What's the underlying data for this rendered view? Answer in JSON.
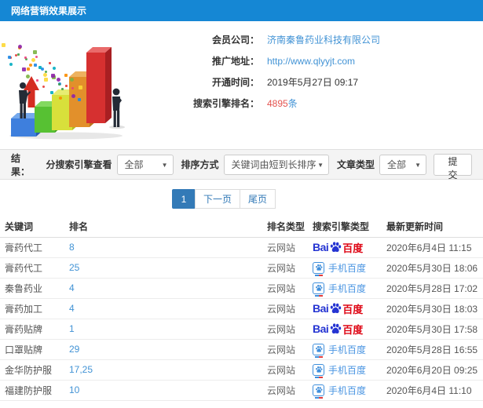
{
  "window": {
    "title": "网络营销效果展示"
  },
  "info": {
    "fields": [
      {
        "label": "会员公司：",
        "value": "济南秦鲁药业科技有限公司"
      },
      {
        "label": "推广地址：",
        "value": "http://www.qlyyjt.com"
      },
      {
        "label": "开通时间：",
        "value": "2019年5月27日 09:17"
      },
      {
        "label": "搜索引擎排名：",
        "value": "4895",
        "unit": "条"
      }
    ]
  },
  "filters": {
    "section_label": "结果：",
    "engine_filter": {
      "label": "分搜索引擎查看",
      "selected": "全部"
    },
    "sort_filter": {
      "label": "排序方式",
      "selected": "关键词由短到长排序"
    },
    "article_type_filter": {
      "label": "文章类型",
      "selected": "全部"
    },
    "submit_label": "提交"
  },
  "pagination": {
    "current": "1",
    "next_label": "下一页",
    "last_label": "尾页"
  },
  "table": {
    "columns": [
      "关键词",
      "排名",
      "排名类型",
      "搜索引擎类型",
      "最新更新时间"
    ],
    "logos": {
      "baidu_bai": "Bai",
      "baidu_du": "百度",
      "mobile_text": "手机百度"
    },
    "rows": [
      {
        "keyword": "膏药代工",
        "rank": "8",
        "rank_type": "云网站",
        "engine": "百度",
        "updated": "2020年6月4日 11:15"
      },
      {
        "keyword": "膏药代工",
        "rank": "25",
        "rank_type": "云网站",
        "engine": "手机百度",
        "updated": "2020年5月30日 18:06"
      },
      {
        "keyword": "秦鲁药业",
        "rank": "4",
        "rank_type": "云网站",
        "engine": "手机百度",
        "updated": "2020年5月28日 17:02"
      },
      {
        "keyword": "膏药加工",
        "rank": "4",
        "rank_type": "云网站",
        "engine": "百度",
        "updated": "2020年5月30日 18:03"
      },
      {
        "keyword": "膏药贴牌",
        "rank": "1",
        "rank_type": "云网站",
        "engine": "百度",
        "updated": "2020年5月30日 17:58"
      },
      {
        "keyword": "口罩贴牌",
        "rank": "29",
        "rank_type": "云网站",
        "engine": "手机百度",
        "updated": "2020年5月28日 16:55"
      },
      {
        "keyword": "金华防护服",
        "rank": "17,25",
        "rank_type": "云网站",
        "engine": "手机百度",
        "updated": "2020年6月20日 09:25"
      },
      {
        "keyword": "福建防护服",
        "rank": "10",
        "rank_type": "云网站",
        "engine": "手机百度",
        "updated": "2020年6月4日 11:10"
      }
    ]
  },
  "colors": {
    "header_bg": "#1587d4",
    "link_blue": "#4293d5",
    "count_red": "#e4534f",
    "pagination_active": "#337ab7",
    "baidu_blue": "#2534d2",
    "baidu_red": "#de0413",
    "mobile_baidu_blue": "#3f8fdc"
  }
}
